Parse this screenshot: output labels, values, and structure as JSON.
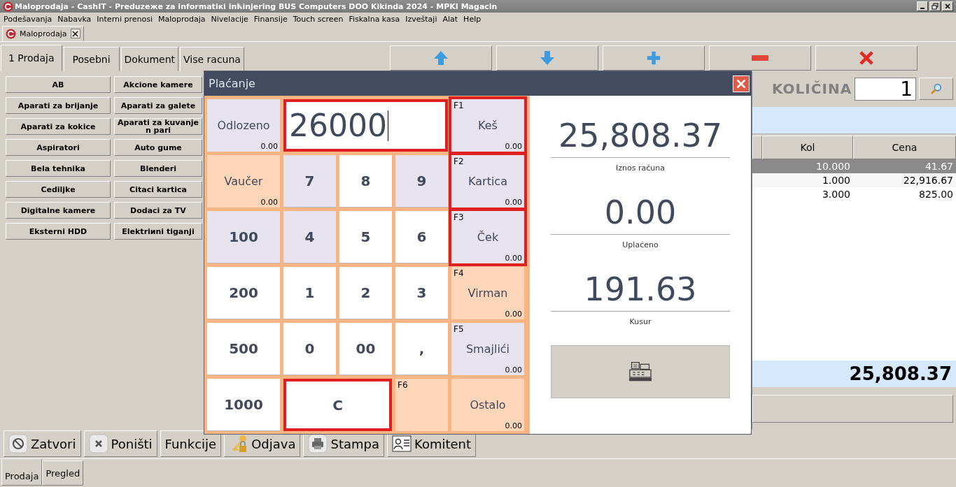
{
  "window": {
    "title": "Maloprodaja - CashIT - Preduzeжe za informatiкi inћinjering BUS Computers DOO Kikinda 2024 - MPKI Magacin"
  },
  "menu": [
    "Podešavanja",
    "Nabavka",
    "Interni prenosi",
    "Maloprodaja",
    "Nivelacije",
    "Finansije",
    "Touch screen",
    "Fiskalna kasa",
    "Izveštaji",
    "Alat",
    "Help"
  ],
  "doc_tab": {
    "label": "Maloprodaja"
  },
  "tabs": [
    {
      "label": "1 Prodaja",
      "selected": true
    },
    {
      "label": "Posebni",
      "selected": false
    },
    {
      "label": "Dokument",
      "selected": false
    },
    {
      "label": "Vise racuna",
      "selected": false
    }
  ],
  "toolbar": [
    {
      "kind": "up"
    },
    {
      "kind": "down"
    },
    {
      "kind": "add"
    },
    {
      "kind": "remove"
    },
    {
      "kind": "delete"
    }
  ],
  "categories": [
    "AB",
    "Akcione kamere",
    "Aparati za brijanje",
    "Aparati za galete",
    "Aparati za kokice",
    "Aparati za kuvanje n pari",
    "Aspiratori",
    "Auto gume",
    "Bela tehnika",
    "Blenderi",
    "Cediljke",
    "Citaci kartica",
    "Digitalne kamere",
    "Dodaci za TV",
    "Eksterni HDD",
    "Elektriиni tiganji"
  ],
  "quantity": {
    "label": "KOLIČINA",
    "value": "1"
  },
  "table": {
    "columns": [
      "Kol",
      "Cena"
    ],
    "rows": [
      {
        "cells": [
          "10.000",
          "41.67"
        ],
        "selected": true
      },
      {
        "cells": [
          "1.000",
          "22,916.67"
        ],
        "selected": false
      },
      {
        "cells": [
          "3.000",
          "825.00"
        ],
        "selected": false
      }
    ]
  },
  "total": "25,808.37",
  "actions": [
    {
      "kind": "close",
      "label": "Zatvori"
    },
    {
      "kind": "cancel",
      "label": "Poništi"
    },
    {
      "kind": "plain",
      "label": "Funkcije"
    },
    {
      "kind": "logout",
      "label": "Odjava"
    },
    {
      "kind": "print",
      "label": "Stampa"
    },
    {
      "kind": "client",
      "label": "Komitent"
    }
  ],
  "bottom_tabs": [
    {
      "label": "Prodaja",
      "selected": true
    },
    {
      "label": "Pregled",
      "selected": false
    }
  ],
  "dialog": {
    "title": "Plaćanje",
    "keys": [
      {
        "kind": "tile",
        "label": "Odlozeno",
        "amount": "0.00",
        "color": "#e6e3ee"
      },
      {
        "kind": "input",
        "value": "26000",
        "highlighted": true
      },
      {
        "kind": "tile",
        "hotkey": "F1",
        "label": "Keš",
        "amount": "0.00",
        "color": "#e6e3ee",
        "highlighted": true
      },
      {
        "kind": "tile",
        "label": "Vaučer",
        "amount": "0.00",
        "color": "#fdd5b8"
      },
      {
        "kind": "digit",
        "label": "7",
        "color": "#e6e3ee"
      },
      {
        "kind": "digit",
        "label": "8",
        "color": "#ffffff"
      },
      {
        "kind": "digit",
        "label": "9",
        "color": "#e6e3ee"
      },
      {
        "kind": "tile",
        "hotkey": "F2",
        "label": "Kartica",
        "amount": "0.00",
        "color": "#e6e3ee",
        "highlighted": true
      },
      {
        "kind": "digit",
        "label": "100",
        "color": "#e6e3ee"
      },
      {
        "kind": "digit",
        "label": "4",
        "color": "#e6e3ee"
      },
      {
        "kind": "digit",
        "label": "5",
        "color": "#ffffff"
      },
      {
        "kind": "digit",
        "label": "6",
        "color": "#ffffff"
      },
      {
        "kind": "tile",
        "hotkey": "F3",
        "label": "Ček",
        "amount": "0.00",
        "color": "#e6e3ee",
        "highlighted": true
      },
      {
        "kind": "digit",
        "label": "200",
        "color": "#ffffff"
      },
      {
        "kind": "digit",
        "label": "1",
        "color": "#ffffff"
      },
      {
        "kind": "digit",
        "label": "2",
        "color": "#ffffff"
      },
      {
        "kind": "digit",
        "label": "3",
        "color": "#ffffff"
      },
      {
        "kind": "tile",
        "hotkey": "F4",
        "label": "Virman",
        "amount": "0.00",
        "color": "#fdd5b8"
      },
      {
        "kind": "digit",
        "label": "500",
        "color": "#ffffff"
      },
      {
        "kind": "digit",
        "label": "0",
        "color": "#ffffff"
      },
      {
        "kind": "digit",
        "label": "00",
        "color": "#ffffff"
      },
      {
        "kind": "digit",
        "label": ",",
        "color": "#ffffff"
      },
      {
        "kind": "tile",
        "hotkey": "F5",
        "label": "Smajlići",
        "amount": "0.00",
        "color": "#e6e3ee"
      },
      {
        "kind": "digit",
        "label": "1000",
        "color": "#ffffff"
      },
      {
        "kind": "clear",
        "label": "C",
        "highlighted": true
      },
      {
        "kind": "tile",
        "hotkey": "F6",
        "color": "#fdd5b8"
      },
      {
        "kind": "tile",
        "label": "Ostalo",
        "amount": "0.00",
        "color": "#fdd5b8"
      }
    ],
    "summary": [
      {
        "value": "25,808.37",
        "caption": "Iznos računa"
      },
      {
        "value": "0.00",
        "caption": "Uplaćeno"
      },
      {
        "value": "191.63",
        "caption": "Kusur"
      }
    ]
  }
}
